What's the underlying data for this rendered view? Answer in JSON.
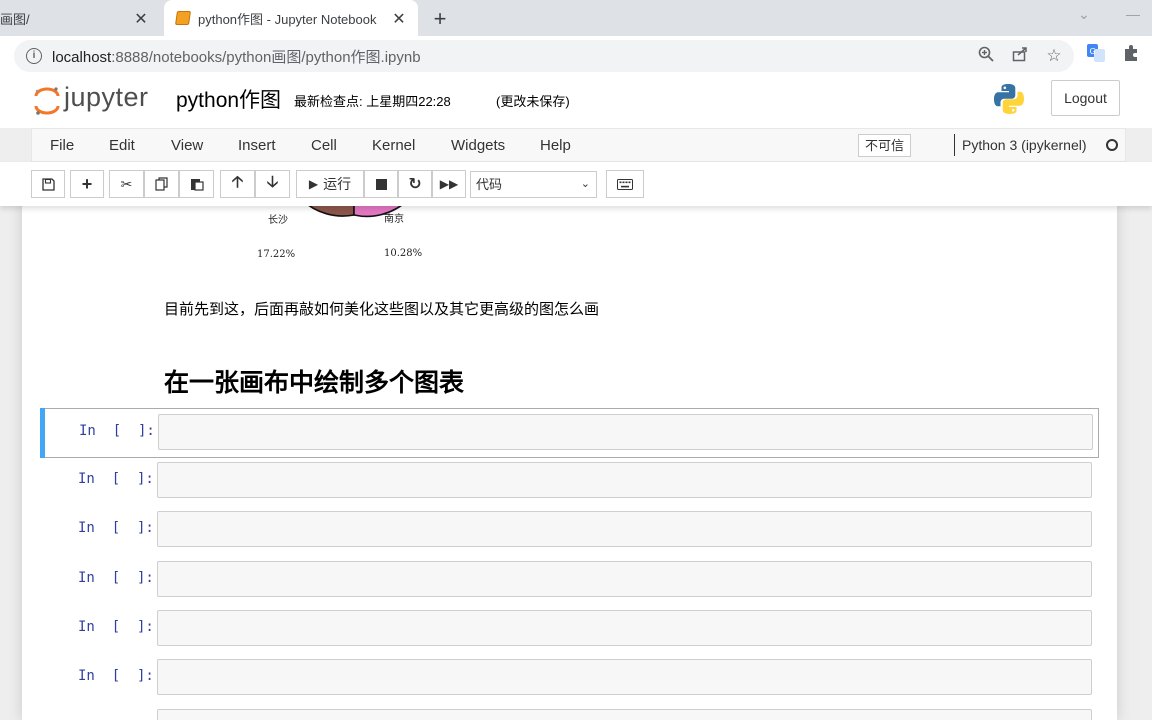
{
  "browser": {
    "tabs": [
      {
        "title": "画图/",
        "active": false
      },
      {
        "title": "python作图 - Jupyter Notebook",
        "active": true
      }
    ],
    "new_tab_symbol": "+",
    "url_host": "localhost",
    "url_rest": ":8888/notebooks/python画图/python作图.ipynb",
    "icons": [
      "info-icon",
      "zoom-icon",
      "share-icon",
      "star-icon",
      "translate-icon",
      "extensions-icon"
    ]
  },
  "header": {
    "logo_text": "jupyter",
    "notebook_name": "python作图",
    "checkpoint": "最新检查点: 上星期四22:28",
    "autosave_status": "(更改未保存)",
    "logout_label": "Logout"
  },
  "menubar": {
    "items": [
      "File",
      "Edit",
      "View",
      "Insert",
      "Cell",
      "Kernel",
      "Widgets",
      "Help"
    ],
    "trust_label": "不可信",
    "kernel_name": "Python 3 (ipykernel)"
  },
  "toolbar": {
    "run_label": "运行",
    "cell_type": "代码"
  },
  "notebook": {
    "pie_labels": [
      {
        "name": "长沙",
        "pct": "17.22%"
      },
      {
        "name": "南京",
        "pct": "10.28%"
      }
    ],
    "markdown_text": "目前先到这，后面再敲如何美化这些图以及其它更高级的图怎么画",
    "heading": "在一张画布中绘制多个图表",
    "cells": [
      {
        "prompt": "In  [  ]:",
        "selected": true
      },
      {
        "prompt": "In  [  ]:",
        "selected": false
      },
      {
        "prompt": "In  [  ]:",
        "selected": false
      },
      {
        "prompt": "In  [  ]:",
        "selected": false
      },
      {
        "prompt": "In  [  ]:",
        "selected": false
      },
      {
        "prompt": "In  [  ]:",
        "selected": false
      }
    ]
  },
  "colors": {
    "selected_bar": "#42a5f5",
    "prompt": "#303f9f",
    "pie_brown": "#8c564b",
    "pie_pink": "#e377c2"
  }
}
